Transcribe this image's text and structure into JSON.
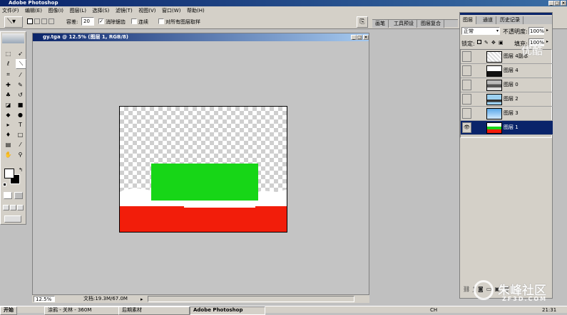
{
  "app": {
    "title": "Adobe Photoshop"
  },
  "menu": [
    "文件(F)",
    "编辑(E)",
    "图像(I)",
    "图层(L)",
    "选择(S)",
    "滤镜(T)",
    "视图(V)",
    "窗口(W)",
    "帮助(H)"
  ],
  "options": {
    "tolerance_label": "容差:",
    "tolerance_value": "20",
    "antialias_label": "消除锯齿",
    "contiguous_label": "连续",
    "all_layers_label": "对所有图层取样"
  },
  "palette_well_tabs": [
    "画笔",
    "工具预设",
    "图层复合"
  ],
  "document": {
    "title": "gy.tga @ 12.5% (图层 1, RGB/8)",
    "zoom": "12.5%",
    "doc_size": "文档:19.3M/67.0M"
  },
  "layers_panel": {
    "tabs": [
      "图层",
      "通道",
      "历史记录"
    ],
    "blend_mode": "正常",
    "opacity_label": "不透明度:",
    "opacity_value": "100%",
    "lock_label": "锁定:",
    "fill_label": "填充:",
    "fill_value": "100%",
    "layers": [
      {
        "name": "图层 4副本",
        "visible": false,
        "selected": false
      },
      {
        "name": "图层 4",
        "visible": false,
        "selected": false
      },
      {
        "name": "图层 0",
        "visible": false,
        "selected": false
      },
      {
        "name": "图层 2",
        "visible": false,
        "selected": false
      },
      {
        "name": "图层 3",
        "visible": false,
        "selected": false
      },
      {
        "name": "图层 1",
        "visible": true,
        "selected": true
      }
    ]
  },
  "taskbar": {
    "start": "开始",
    "items": [
      "涂鸦 - 关林 - 360M",
      "后期素材",
      "Adobe Photoshop"
    ],
    "lang": "CH",
    "clock": "21:31"
  },
  "watermarks": {
    "top_right": "优酷",
    "bottom_right": "朱峰社区",
    "bottom_right_sub": "ZF3D.COM"
  },
  "colors": {
    "canvas_green": "#17d617",
    "canvas_red": "#f21d0a",
    "selection_blue": "#0a246a"
  }
}
